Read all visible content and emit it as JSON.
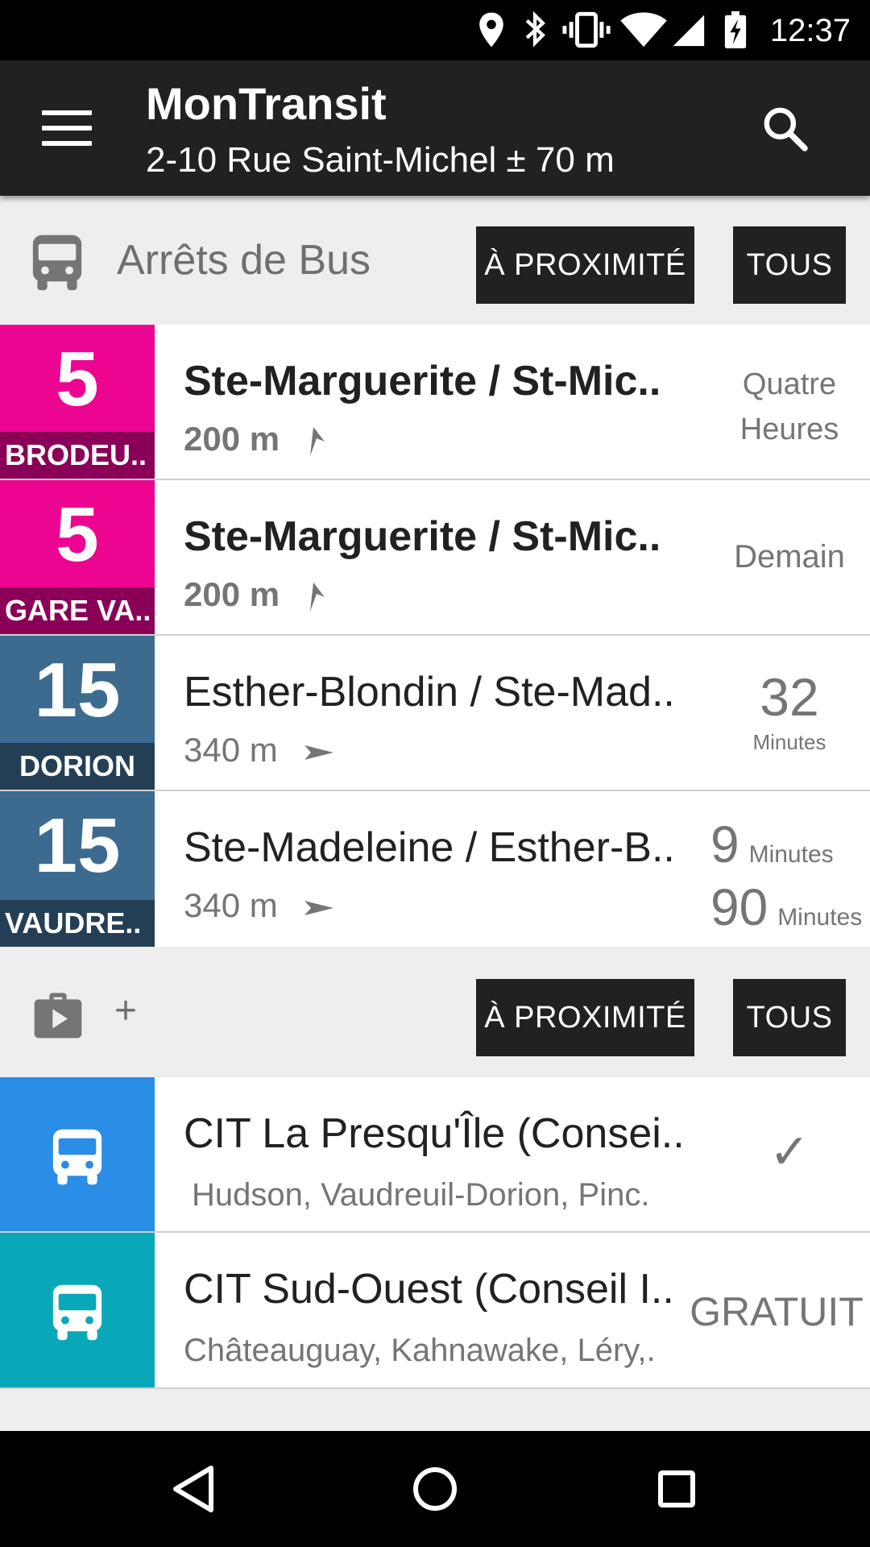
{
  "status_bar": {
    "time": "12:37",
    "icons": [
      "location-icon",
      "bluetooth-icon",
      "vibrate-icon",
      "wifi-icon",
      "signal-icon",
      "battery-icon"
    ]
  },
  "toolbar": {
    "title": "MonTransit",
    "subtitle": "2-10 Rue Saint-Michel ± 70 m"
  },
  "bus_section": {
    "title": "Arrêts de Bus",
    "nearby_label": "À PROXIMITÉ",
    "all_label": "TOUS",
    "rows": [
      {
        "route": "5",
        "headsign": "BRODEU..",
        "color": "#ec0591",
        "head_color": "#8a0057",
        "stop": "Ste-Marguerite / St-Mic..",
        "distance": "200 m",
        "bold": true,
        "status_lines": [
          "Quatre",
          "Heures"
        ]
      },
      {
        "route": "5",
        "headsign": "GARE VA..",
        "color": "#ec0591",
        "head_color": "#8a0057",
        "stop": "Ste-Marguerite / St-Mic..",
        "distance": "200 m",
        "bold": true,
        "status_lines": [
          "Demain"
        ]
      },
      {
        "route": "15",
        "headsign": "DORION",
        "color": "#3d6b8f",
        "head_color": "#243f55",
        "stop": "Esther-Blondin / Ste-Mad..",
        "distance": "340 m",
        "bold": false,
        "status_num": "32",
        "status_unit": "Minutes"
      },
      {
        "route": "15",
        "headsign": "VAUDRE..",
        "color": "#3d6b8f",
        "head_color": "#243f55",
        "stop": "Ste-Madeleine / Esther-B..",
        "distance": "340 m",
        "bold": false,
        "status_times": [
          {
            "num": "9",
            "unit": "Minutes"
          },
          {
            "num": "90",
            "unit": "Minutes"
          }
        ]
      }
    ]
  },
  "agency_section": {
    "plus_label": "+",
    "nearby_label": "À PROXIMITÉ",
    "all_label": "TOUS",
    "rows": [
      {
        "name": "CIT La Presqu'Île (Consei..",
        "areas": "Hudson, Vaudreuil-Dorion, Pinc.",
        "color": "#2a8de6",
        "status": "✓"
      },
      {
        "name": "CIT Sud-Ouest (Conseil I..",
        "areas": "Châteauguay, Kahnawake, Léry,.",
        "color": "#08a8b8",
        "status": "GRATUIT"
      }
    ]
  },
  "nav_bar": {
    "buttons": [
      "back-icon",
      "home-icon",
      "recents-icon"
    ]
  }
}
